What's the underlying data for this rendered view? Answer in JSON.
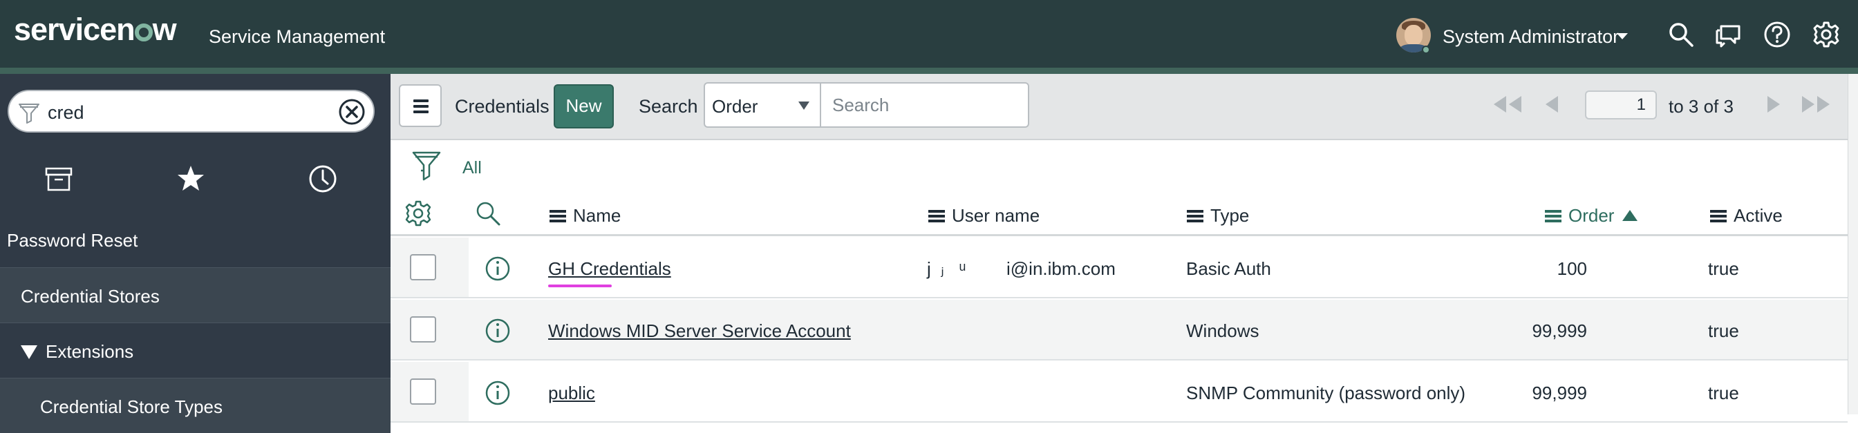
{
  "header": {
    "logo_text_a": "servicen",
    "logo_text_b": "w",
    "app_title": "Service Management",
    "user_name": "System Administrator",
    "icons": [
      "search-icon",
      "connect-chat-icon",
      "help-icon",
      "gear-icon"
    ],
    "bg_color": "#293e40",
    "accent_color": "#81b5a1"
  },
  "sidebar": {
    "filter": {
      "value": "cred",
      "placeholder": ""
    },
    "tabs": [
      "all-apps-icon",
      "favorites-star-icon",
      "history-clock-icon"
    ],
    "nav": {
      "app": "Password Reset",
      "items": [
        {
          "label": "Credential Stores"
        },
        {
          "label": "Extensions"
        },
        {
          "label": "Credential Store Types"
        }
      ]
    }
  },
  "list": {
    "title": "Credentials",
    "new_label": "New",
    "search_label": "Search",
    "search_field": "Order",
    "search_placeholder": "Search",
    "page_value": "1",
    "page_range": "to 3 of 3",
    "breadcrumb": "All",
    "columns": {
      "name": "Name",
      "user_name": "User name",
      "type": "Type",
      "order": "Order",
      "active": "Active"
    },
    "sorted_column": "order",
    "sort_direction": "ascending",
    "rows": [
      {
        "name": "GH Credentials",
        "user_name_visible": "i@in.ibm.com",
        "type": "Basic Auth",
        "order": "100",
        "active": "true"
      },
      {
        "name": "Windows MID Server Service Account",
        "user_name_visible": "",
        "type": "Windows",
        "order": "99,999",
        "active": "true"
      },
      {
        "name": "public",
        "user_name_visible": "",
        "type": "SNMP Community (password only)",
        "order": "99,999",
        "active": "true"
      }
    ]
  }
}
